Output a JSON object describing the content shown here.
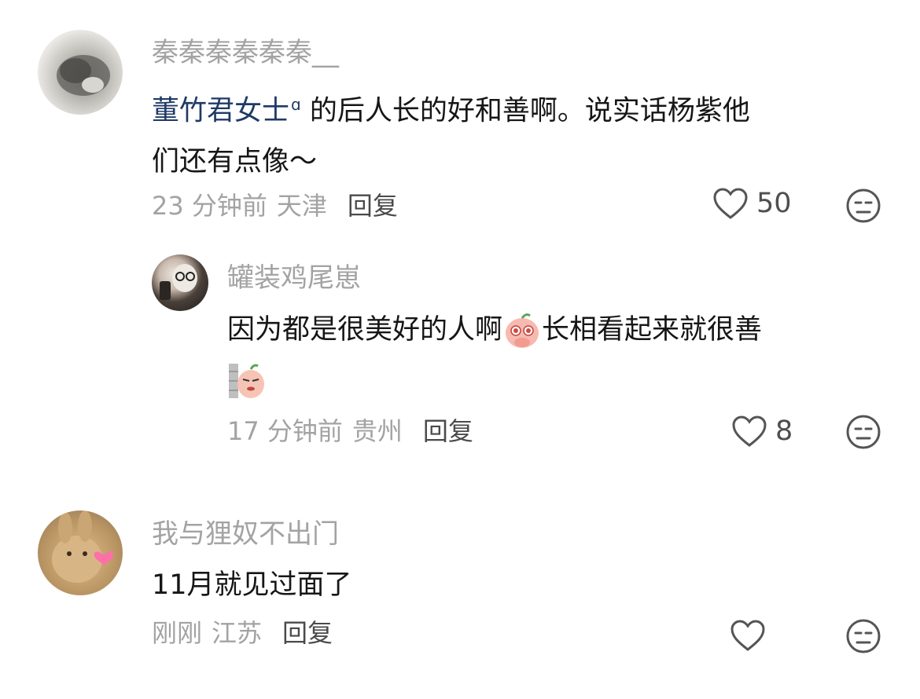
{
  "comments": [
    {
      "username": "秦秦秦秦秦秦__",
      "mention": "董竹君女士",
      "text_line1": " 的后人长的好和善啊。说实话杨紫他",
      "text_line2": "们还有点像～",
      "time": "23 分钟前",
      "location": "天津",
      "reply_label": "回复",
      "likes": "50",
      "avatar_icon": "cat-avatar"
    },
    {
      "username": "罐装鸡尾崽",
      "text_line1": "因为都是很美好的人啊",
      "text_after_emoji": "长相看起来就很善",
      "time": "17 分钟前",
      "location": "贵州",
      "reply_label": "回复",
      "likes": "8",
      "avatar_icon": "selfie-avatar",
      "emoji_1": "pleading-peach-emoji",
      "emoji_2": "peeking-peach-emoji"
    },
    {
      "username": "我与狸奴不出门",
      "text_line1": "11月就见过面了",
      "time": "刚刚",
      "location": "江苏",
      "reply_label": "回复",
      "likes": "",
      "avatar_icon": "rabbit-plush-avatar"
    }
  ],
  "colors": {
    "username": "#a3a3a3",
    "mention": "#1f3a66",
    "text": "#161616",
    "meta": "#a3a3a3",
    "reply": "#4a4a4a"
  }
}
